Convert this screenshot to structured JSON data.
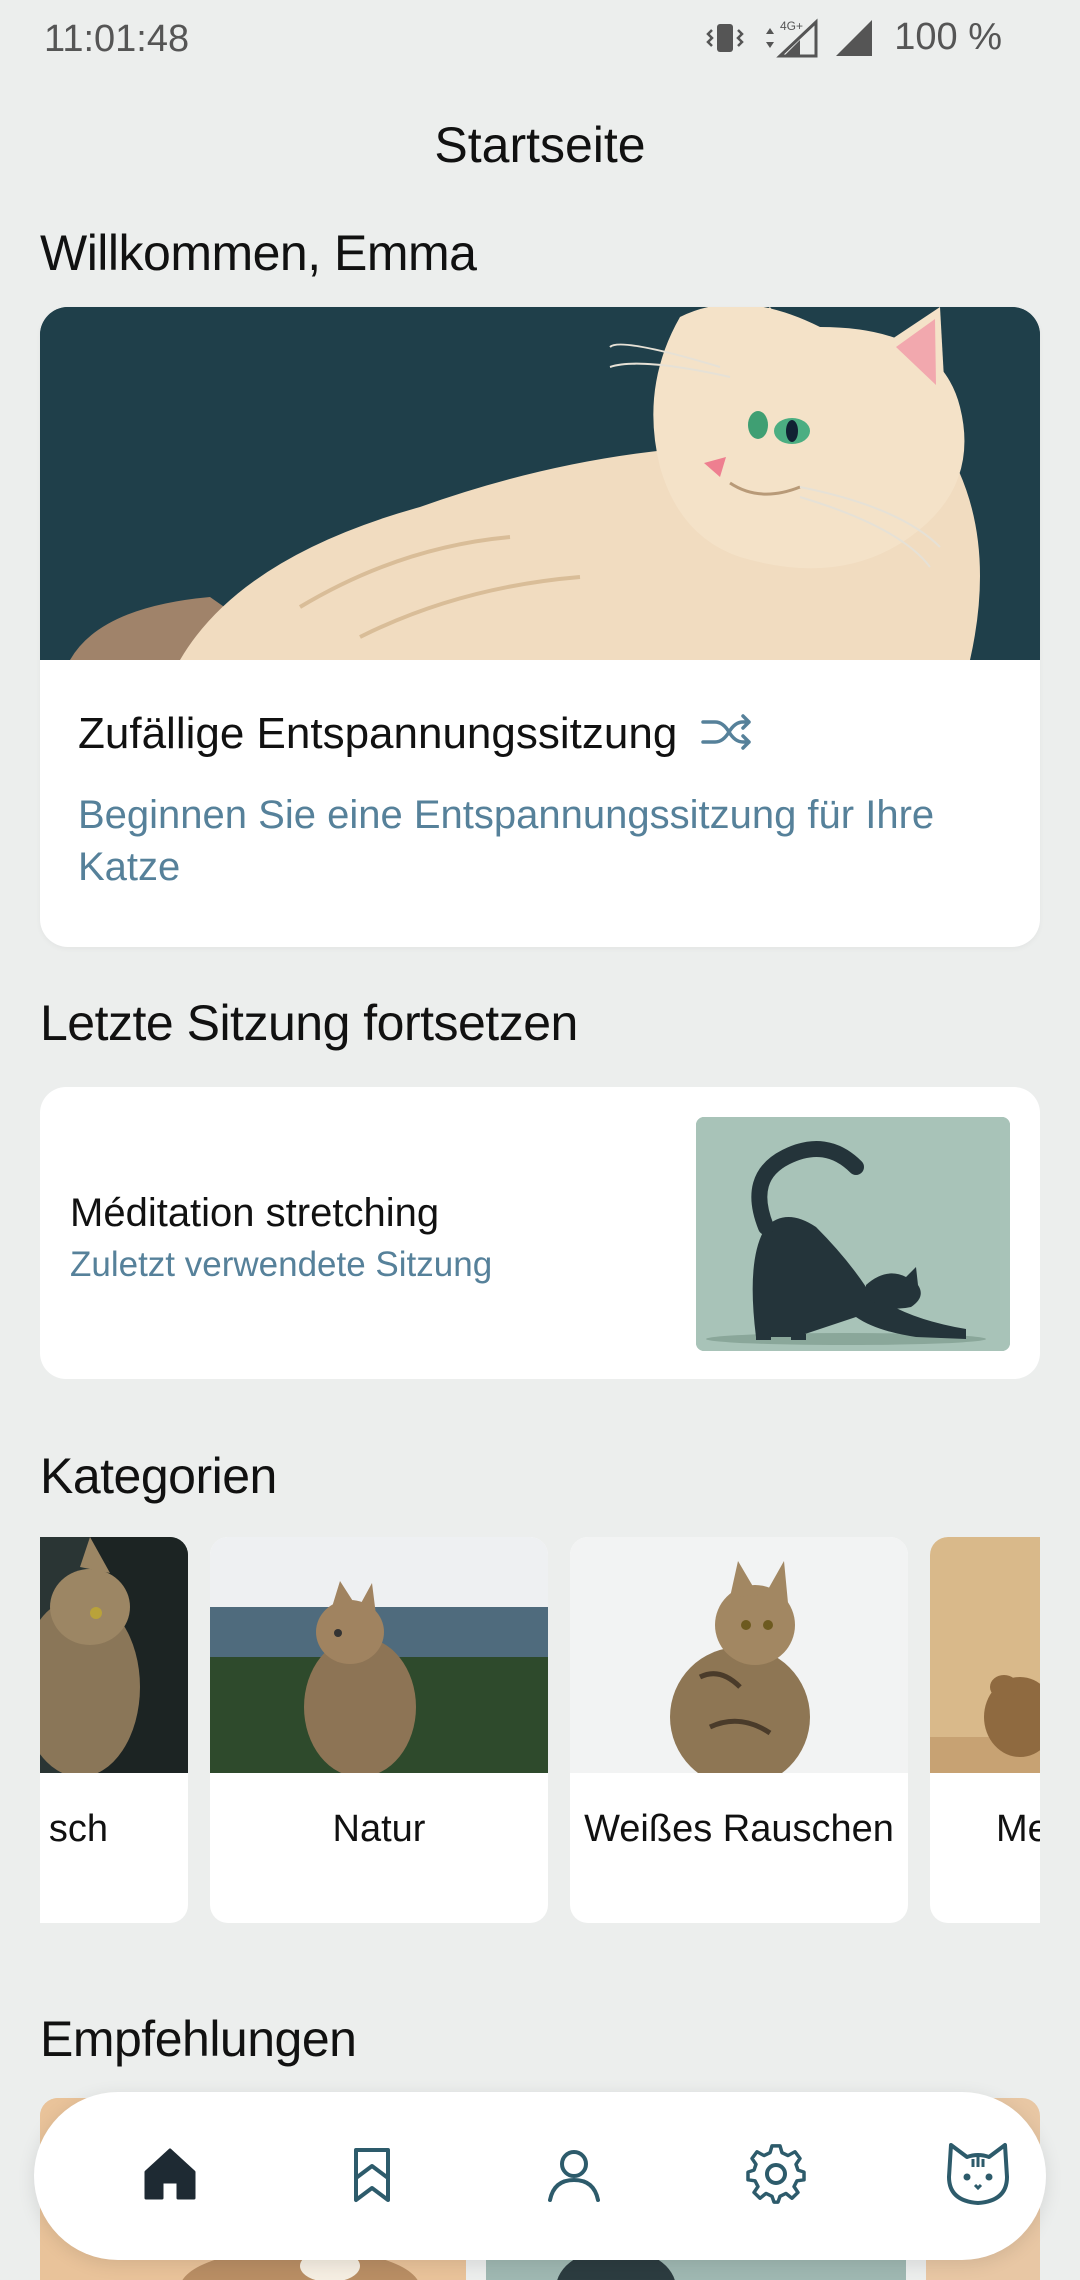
{
  "status_bar": {
    "time": "11:01:48",
    "network": "4G+",
    "battery": "100 %"
  },
  "header": {
    "title": "Startseite"
  },
  "welcome": {
    "title": "Willkommen, Emma"
  },
  "hero_card": {
    "title": "Zufällige Entspannungssitzung",
    "description": "Beginnen Sie eine Entspannungssitzung für Ihre Katze",
    "icon": "shuffle-icon"
  },
  "continue_section": {
    "title": "Letzte Sitzung fortsetzen",
    "session_title": "Méditation stretching",
    "session_subtitle": "Zuletzt verwendete Sitzung"
  },
  "categories": {
    "title": "Kategorien",
    "items": [
      {
        "label": "sch"
      },
      {
        "label": "Natur"
      },
      {
        "label": "Weißes Rauschen"
      },
      {
        "label": "Me"
      }
    ]
  },
  "recommendations": {
    "title": "Empfehlungen"
  },
  "bottom_nav": {
    "items": [
      {
        "icon": "home-icon",
        "active": true
      },
      {
        "icon": "bookmark-icon",
        "active": false
      },
      {
        "icon": "profile-icon",
        "active": false
      },
      {
        "icon": "gear-icon",
        "active": false
      },
      {
        "icon": "cat-icon",
        "active": false
      }
    ]
  },
  "colors": {
    "background": "#eceeed",
    "accent_text": "#56819a",
    "icon": "#2d5b6b",
    "hero_bg": "#1f3f4a"
  }
}
